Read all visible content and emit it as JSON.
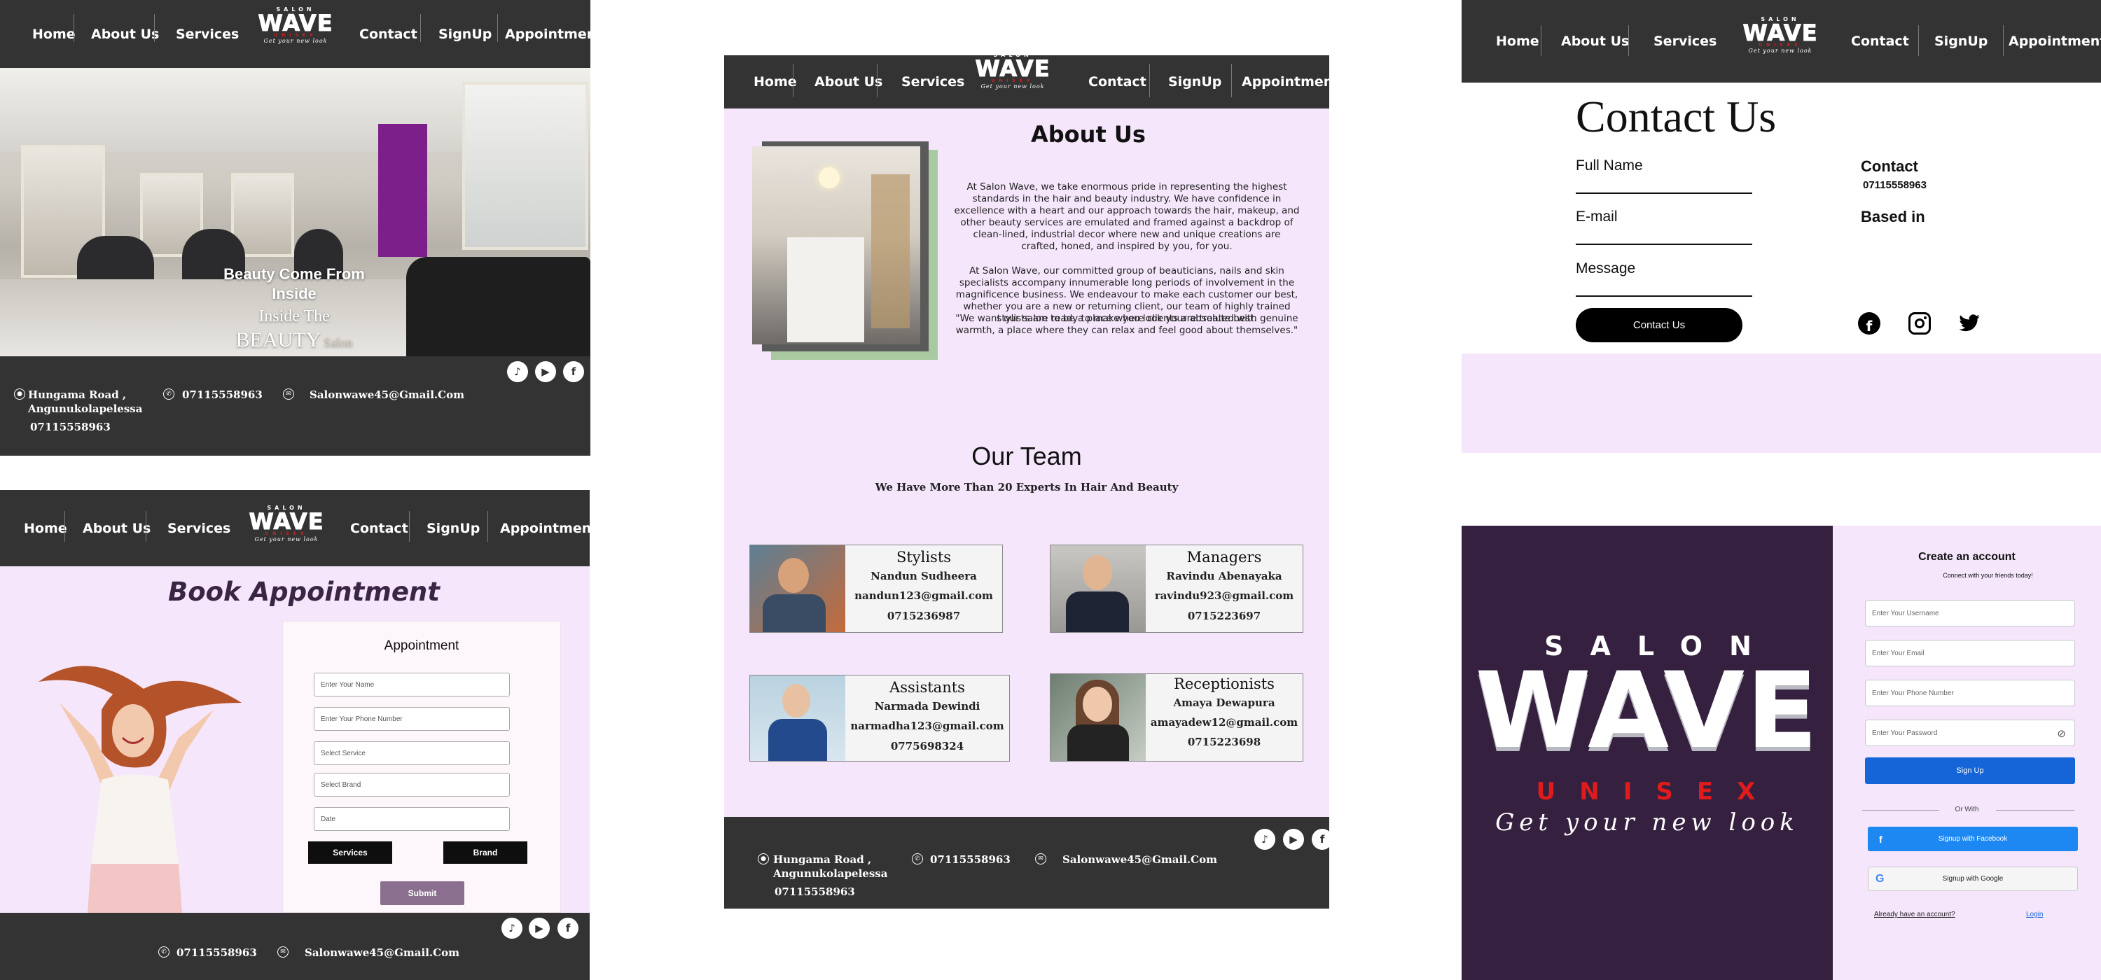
{
  "nav": {
    "home": "Home",
    "about": "About Us",
    "services": "Services",
    "contact": "Contact",
    "signup": "SignUp",
    "appointment": "Appointment"
  },
  "logo": {
    "salon": "SALON",
    "wave": "WAVE",
    "unisex": "UNISEX",
    "tagline": "Get your new look"
  },
  "footer": {
    "address_line1": "Hungama Road ,",
    "address_line2": "Angunukolapelessa",
    "address_phone": "07115558963",
    "phone": "07115558963",
    "email": "Salonwawe45@Gmail.Com"
  },
  "social": {
    "tiktok_icon": "tiktok-icon",
    "youtube_icon": "youtube-icon",
    "facebook_icon": "facebook-icon"
  },
  "home": {
    "hero_line1": "Beauty Come From",
    "hero_line2": "Inside",
    "hero_line3": "Inside The",
    "hero_line4": "BEAUTY",
    "hero_line4_suffix": "Salon"
  },
  "about": {
    "title": "About Us",
    "paragraph1": "At Salon Wave, we take enormous pride in representing the highest standards in the hair and beauty industry. We have confidence in excellence with a heart and our approach towards the hair, makeup, and other beauty services are emulated and framed against a backdrop of clean-lined, industrial decor where new and unique creations are crafted, honed, and inspired by you, for you.",
    "paragraph2": "At Salon Wave, our committed group of beauticians, nails and skin specialists accompany innumerable long periods of involvement in the magnificence business. We endeavour to make each customer our best, whether you are a new or returning client, our team of highly trained stylists are ready to make you look your absolute best.",
    "paragraph3": "\"We want our salon to be a place where clients are treated with genuine warmth, a place where they can relax and feel good about themselves.\"",
    "team_title": "Our Team",
    "team_subtitle": "We Have More Than 20 Experts In Hair And Beauty",
    "team": [
      {
        "role": "Stylists",
        "name": "Nandun Sudheera",
        "email": "nandun123@gmail.com",
        "phone": "0715236987"
      },
      {
        "role": "Managers",
        "name": "Ravindu Abenayaka",
        "email": "ravindu923@gmail.com",
        "phone": "0715223697"
      },
      {
        "role": "Assistants",
        "name": "Narmada Dewindi",
        "email": "narmadha123@gmail.com",
        "phone": "0775698324"
      },
      {
        "role": "Receptionists",
        "name": "Amaya Dewapura",
        "email": "amayadew12@gmail.com",
        "phone": "0715223698"
      }
    ]
  },
  "appointment": {
    "page_title": "Book Appointment",
    "form_title": "Appointment",
    "name_placeholder": "Enter Your Name",
    "phone_placeholder": "Enter Your Phone Number",
    "service_placeholder": "Select Service",
    "brand_placeholder": "Select Brand",
    "date_placeholder": "Date",
    "services_button": "Services",
    "brand_button": "Brand",
    "submit_button": "Submit"
  },
  "contact": {
    "title": "Contact Us",
    "full_name_label": "Full Name",
    "email_label": "E-mail",
    "message_label": "Message",
    "button": "Contact Us",
    "contact_heading": "Contact",
    "contact_phone": "07115558963",
    "based_in_heading": "Based in",
    "facebook_icon": "facebook-icon",
    "instagram_icon": "instagram-icon",
    "twitter_icon": "twitter-icon"
  },
  "signup": {
    "title": "Create an account",
    "subtitle": "Connect with your friends today!",
    "username_placeholder": "Enter Your Username",
    "email_placeholder": "Enter Your Email",
    "phone_placeholder": "Enter Your Phone Number",
    "password_placeholder": "Enter Your Password",
    "signup_button": "Sign Up",
    "divider": "Or With",
    "facebook_button": "Signup with Facebook",
    "google_button": "Signup with Google",
    "already": "Already have an account?",
    "login_link": "Login"
  },
  "colors": {
    "nav_bg": "#333333",
    "lavender_bg": "#f5e6fb",
    "signup_dark": "#35213f",
    "primary_blue": "#1565d8",
    "accent_red": "#e01b1b",
    "submit_purple": "#8a6f8e"
  }
}
